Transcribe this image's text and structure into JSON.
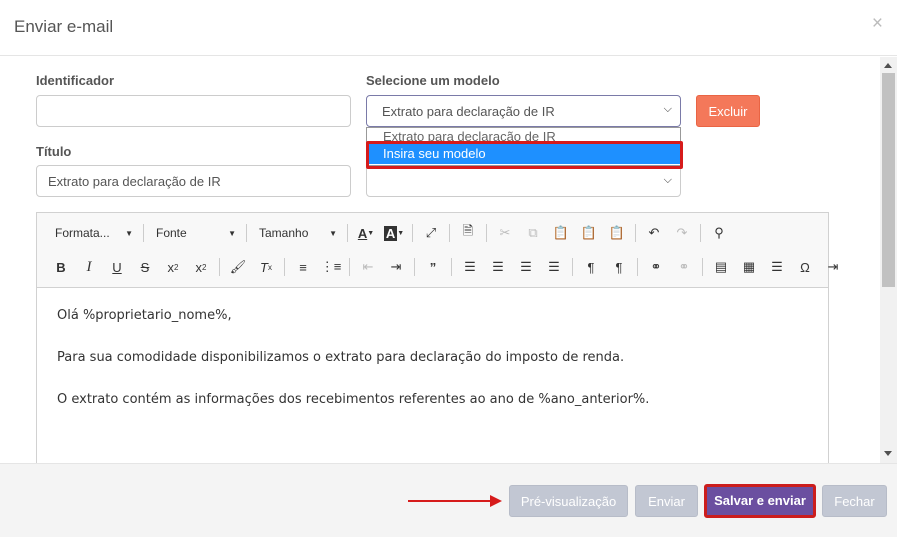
{
  "modal": {
    "title": "Enviar e-mail",
    "close_glyph": "×"
  },
  "form": {
    "identificador_label": "Identificador",
    "identificador_value": "",
    "modelo_label": "Selecione um modelo",
    "modelo_selected": "Extrato para declaração de IR",
    "excluir_label": "Excluir",
    "dropdown_options": [
      "Extrato para declaração de IR",
      "Insira seu modelo"
    ],
    "titulo_label": "Título",
    "titulo_value": "Extrato para declaração de IR"
  },
  "toolbar": {
    "format_label": "Formata...",
    "font_label": "Fonte",
    "size_label": "Tamanho"
  },
  "editor": {
    "lines": [
      "Olá %proprietario_nome%,",
      "Para sua comodidade disponibilizamos o extrato para declaração do imposto de renda.",
      "O extrato contém as informações dos recebimentos referentes ao ano de %ano_anterior%."
    ]
  },
  "footer": {
    "preview_label": "Pré-visualização",
    "send_label": "Enviar",
    "save_send_label": "Salvar e enviar",
    "close_label": "Fechar"
  },
  "colors": {
    "danger": "#f4785a",
    "primary": "#6b4fa0",
    "highlight": "#d61b1b",
    "selected_option": "#1e90ff"
  }
}
